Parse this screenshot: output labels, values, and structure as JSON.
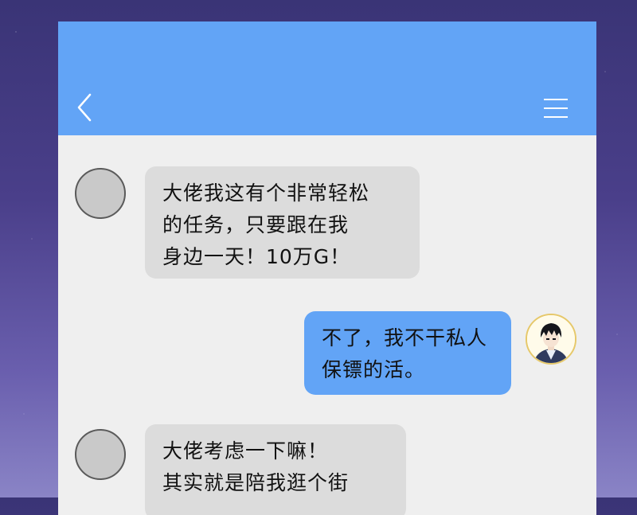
{
  "header": {
    "back_icon": "chevron-left-icon",
    "menu_icon": "hamburger-menu-icon"
  },
  "colors": {
    "header_bg": "#62a4f6",
    "chat_bg": "#efefef",
    "incoming_bubble": "#dcdcdc",
    "outgoing_bubble": "#62a4f6"
  },
  "messages": [
    {
      "sender": "other",
      "lines": [
        "大佬我这有个非常轻松",
        "的任务，只要跟在我",
        "身边一天！10万G！"
      ]
    },
    {
      "sender": "me",
      "lines": [
        "不了，我不干私人",
        "保镖的活。"
      ]
    },
    {
      "sender": "other",
      "lines": [
        "大佬考虑一下嘛！",
        "其实就是陪我逛个街"
      ]
    }
  ]
}
